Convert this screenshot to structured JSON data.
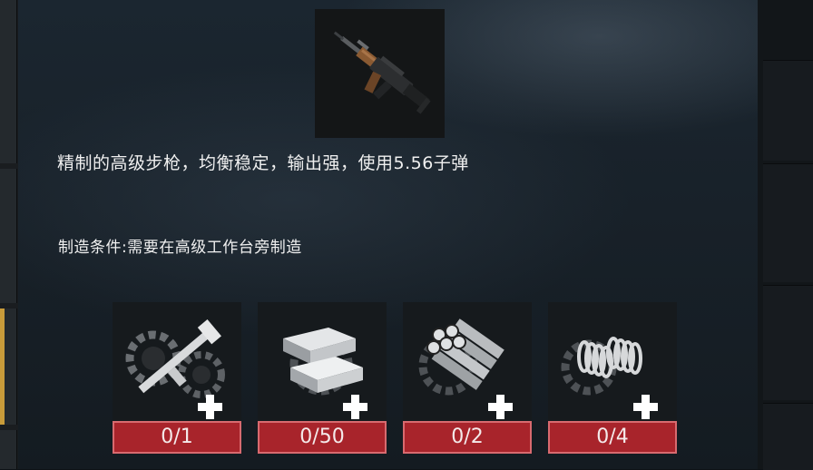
{
  "item": {
    "icon": "assault-rifle-icon",
    "description": "精制的高级步枪，均衡稳定，输出强，使用5.56子弹",
    "condition": "制造条件:需要在高级工作台旁制造"
  },
  "materials": [
    {
      "icon": "rifle-parts-icon",
      "count": "0/1"
    },
    {
      "icon": "metal-ingot-icon",
      "count": "0/50"
    },
    {
      "icon": "steel-pipes-icon",
      "count": "0/2"
    },
    {
      "icon": "springs-icon",
      "count": "0/4"
    }
  ],
  "colors": {
    "count_bg": "#a8242b",
    "count_border": "#d86a6f",
    "accent": "#c89b3a"
  }
}
